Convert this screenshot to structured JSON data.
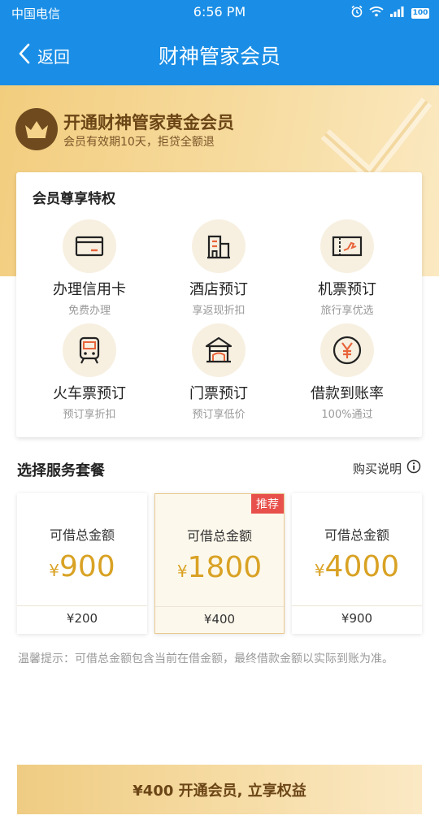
{
  "status_bar": {
    "carrier": "中国电信",
    "time": "6:56 PM",
    "battery": "100"
  },
  "nav": {
    "back_label": "返回",
    "title": "财神管家会员"
  },
  "hero": {
    "title": "开通财神管家黄金会员",
    "subtitle": "会员有效期10天，拒贷全额退"
  },
  "privileges": {
    "title": "会员尊享特权",
    "items": [
      {
        "label": "办理信用卡",
        "desc": "免费办理",
        "icon": "credit-card-icon"
      },
      {
        "label": "酒店预订",
        "desc": "享返现折扣",
        "icon": "hotel-icon"
      },
      {
        "label": "机票预订",
        "desc": "旅行享优选",
        "icon": "flight-ticket-icon"
      },
      {
        "label": "火车票预订",
        "desc": "预订享折扣",
        "icon": "train-icon"
      },
      {
        "label": "门票预订",
        "desc": "预订享低价",
        "icon": "pavilion-icon"
      },
      {
        "label": "借款到账率",
        "desc": "100%通过",
        "icon": "yen-coin-icon"
      }
    ]
  },
  "packages_section": {
    "title": "选择服务套餐",
    "buy_note": "购买说明"
  },
  "packages": [
    {
      "label": "可借总金额",
      "currency": "¥",
      "amount": "900",
      "price": "¥200",
      "selected": false
    },
    {
      "label": "可借总金额",
      "currency": "¥",
      "amount": "1800",
      "price": "¥400",
      "selected": true,
      "badge": "推荐"
    },
    {
      "label": "可借总金额",
      "currency": "¥",
      "amount": "4000",
      "price": "¥900",
      "selected": false
    }
  ],
  "tip": "温馨提示：可借总金额包含当前在借金额，最终借款金额以实际到账为准。",
  "cta": {
    "label": "¥400 开通会员, 立享权益"
  },
  "colors": {
    "primary_blue": "#1a8ee6",
    "gold_text": "#d9a224",
    "brown": "#6b4516",
    "badge_red": "#e8504b",
    "icon_orange": "#e8643a"
  }
}
